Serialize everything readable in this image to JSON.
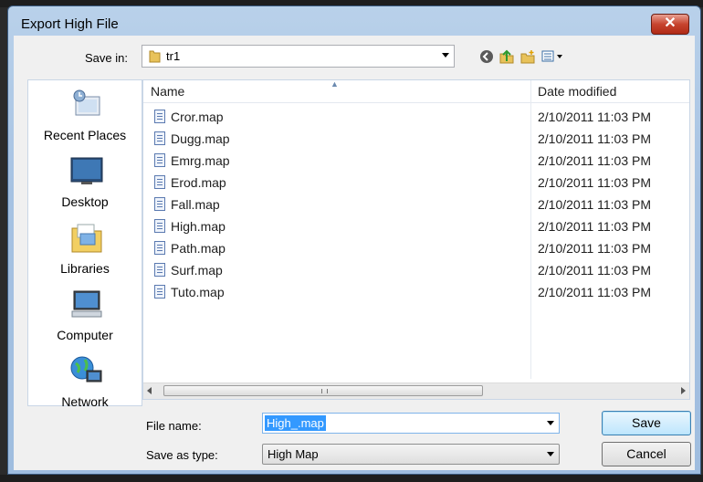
{
  "window": {
    "title": "Export High File",
    "close_glyph": "✕"
  },
  "toolbar": {
    "save_in_label": "Save in:",
    "save_in_value": "tr1",
    "buttons": [
      "back-icon",
      "up-folder-icon",
      "new-folder-icon",
      "views-menu-icon"
    ]
  },
  "places": [
    {
      "label": "Recent Places",
      "icon": "recent-places-icon"
    },
    {
      "label": "Desktop",
      "icon": "desktop-icon"
    },
    {
      "label": "Libraries",
      "icon": "libraries-icon"
    },
    {
      "label": "Computer",
      "icon": "computer-icon"
    },
    {
      "label": "Network",
      "icon": "network-icon"
    }
  ],
  "filelist": {
    "columns": {
      "name": "Name",
      "date": "Date modified"
    },
    "files": [
      {
        "name": "Cror.map",
        "date": "2/10/2011 11:03 PM"
      },
      {
        "name": "Dugg.map",
        "date": "2/10/2011 11:03 PM"
      },
      {
        "name": "Emrg.map",
        "date": "2/10/2011 11:03 PM"
      },
      {
        "name": "Erod.map",
        "date": "2/10/2011 11:03 PM"
      },
      {
        "name": "Fall.map",
        "date": "2/10/2011 11:03 PM"
      },
      {
        "name": "High.map",
        "date": "2/10/2011 11:03 PM"
      },
      {
        "name": "Path.map",
        "date": "2/10/2011 11:03 PM"
      },
      {
        "name": "Surf.map",
        "date": "2/10/2011 11:03 PM"
      },
      {
        "name": "Tuto.map",
        "date": "2/10/2011 11:03 PM"
      }
    ]
  },
  "form": {
    "file_name_label": "File name:",
    "file_name_value": "High_.map",
    "save_as_type_label": "Save as type:",
    "save_as_type_value": "High Map"
  },
  "buttons": {
    "save": "Save",
    "cancel": "Cancel"
  },
  "colors": {
    "title_bar": "#a6c2e2",
    "close": "#c7442e",
    "selection": "#3399ff"
  }
}
